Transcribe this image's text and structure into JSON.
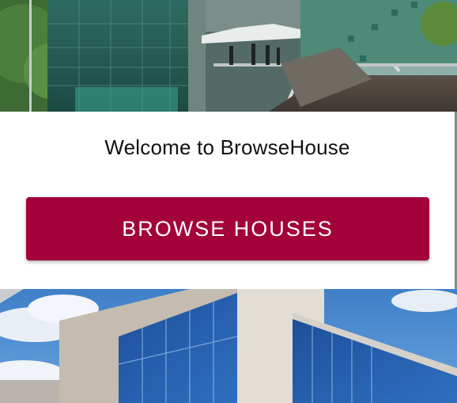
{
  "welcome": {
    "title": "Welcome to BrowseHouse",
    "button_label": "BROWSE HOUSES"
  },
  "colors": {
    "button": "#a3033a",
    "card": "#ffffff",
    "title_text": "#111111"
  }
}
